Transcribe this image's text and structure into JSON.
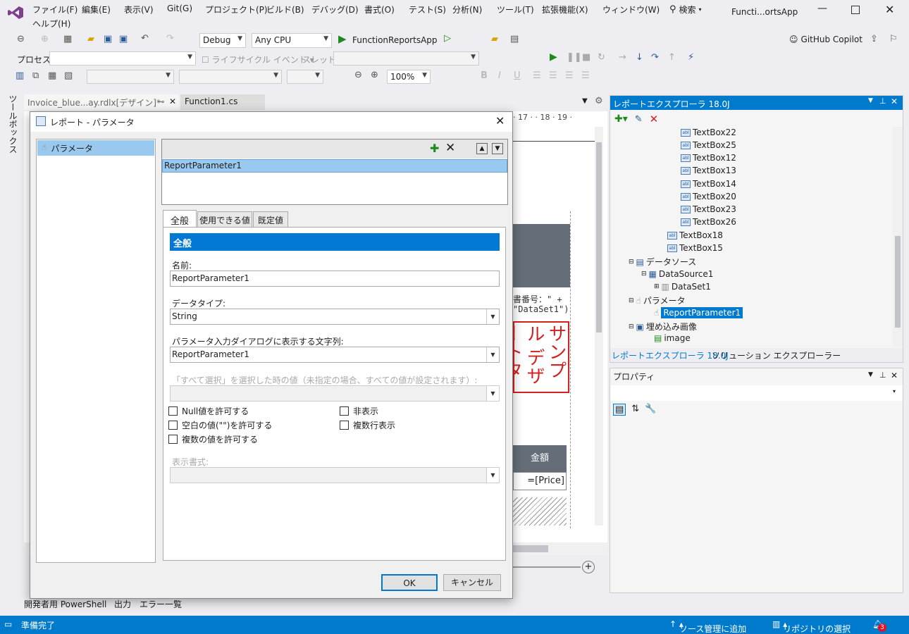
{
  "menu": {
    "items": [
      "ファイル(F)",
      "編集(E)",
      "表示(V)",
      "Git(G)",
      "プロジェクト(P)",
      "ビルド(B)",
      "デバッグ(D)",
      "書式(O)",
      "テスト(S)",
      "分析(N)",
      "ツール(T)",
      "拡張機能(X)",
      "ウィンドウ(W)"
    ],
    "help": "ヘルプ(H)",
    "search": "検索",
    "title": "Functi...ortsApp"
  },
  "toolbar": {
    "config": "Debug",
    "platform": "Any CPU",
    "run_target": "FunctionReportsApp",
    "copilot": "GitHub Copilot",
    "process_label": "プロセス:",
    "lifecycle_label": "ライフサイクル イベント",
    "thread_label": "スレッド:",
    "zoom": "100%"
  },
  "toolbox_label": "ツールボックス",
  "doc_tabs": {
    "tab1": "Invoice_blue...ay.rdlx[デザイン]*",
    "tab2": "Function1.cs"
  },
  "designer": {
    "ruler": "· 17 · · 18 · 19 ·",
    "text1": "書番号：\" +",
    "text2": "\"DataSet1\")",
    "stamp": "サンプル デザートタ 株式",
    "col_header": "金額",
    "cell": "=[Price]"
  },
  "dialog": {
    "title": "レポート - パラメータ",
    "left_item": "パラメータ",
    "param_selected": "ReportParameter1",
    "tabs": [
      "全般",
      "使用できる値",
      "既定値"
    ],
    "section_title": "全般",
    "name_label": "名前:",
    "name_value": "ReportParameter1",
    "datatype_label": "データタイプ:",
    "datatype_value": "String",
    "prompt_label": "パラメータ入力ダイアログに表示する文字列:",
    "prompt_value": "ReportParameter1",
    "select_all_label": "「すべて選択」を選択した時の値（未指定の場合、すべての値が設定されます）:",
    "chk_null": "Null値を許可する",
    "chk_blank": "空白の値(\"\")を許可する",
    "chk_multi": "複数の値を許可する",
    "chk_hidden": "非表示",
    "chk_multiline": "複数行表示",
    "format_label": "表示書式:",
    "ok": "OK",
    "cancel": "キャンセル"
  },
  "explorer": {
    "title": "レポートエクスプローラ 18.0J",
    "items": [
      {
        "label": "TextBox22"
      },
      {
        "label": "TextBox25"
      },
      {
        "label": "TextBox12"
      },
      {
        "label": "TextBox13"
      },
      {
        "label": "TextBox14"
      },
      {
        "label": "TextBox20"
      },
      {
        "label": "TextBox23"
      },
      {
        "label": "TextBox26"
      },
      {
        "label": "TextBox18"
      },
      {
        "label": "TextBox15"
      },
      {
        "label": "データソース"
      },
      {
        "label": "DataSource1"
      },
      {
        "label": "DataSet1"
      },
      {
        "label": "パラメータ"
      },
      {
        "label": "ReportParameter1"
      },
      {
        "label": "埋め込み画像"
      },
      {
        "label": "image"
      }
    ],
    "tab1": "レポートエクスプローラ 18.0J",
    "tab2": "ソリューション エクスプローラー"
  },
  "properties": {
    "title": "プロパティ"
  },
  "bottom_tabs": [
    "開発者用 PowerShell",
    "出力",
    "エラー一覧"
  ],
  "status": {
    "ready": "準備完了",
    "source_control": "ソース管理に追加",
    "repo": "リポジトリの選択",
    "notifications": "3"
  },
  "colors": {
    "accent": "#007acc",
    "selection": "#99c9ef",
    "stamp": "#d42020"
  }
}
